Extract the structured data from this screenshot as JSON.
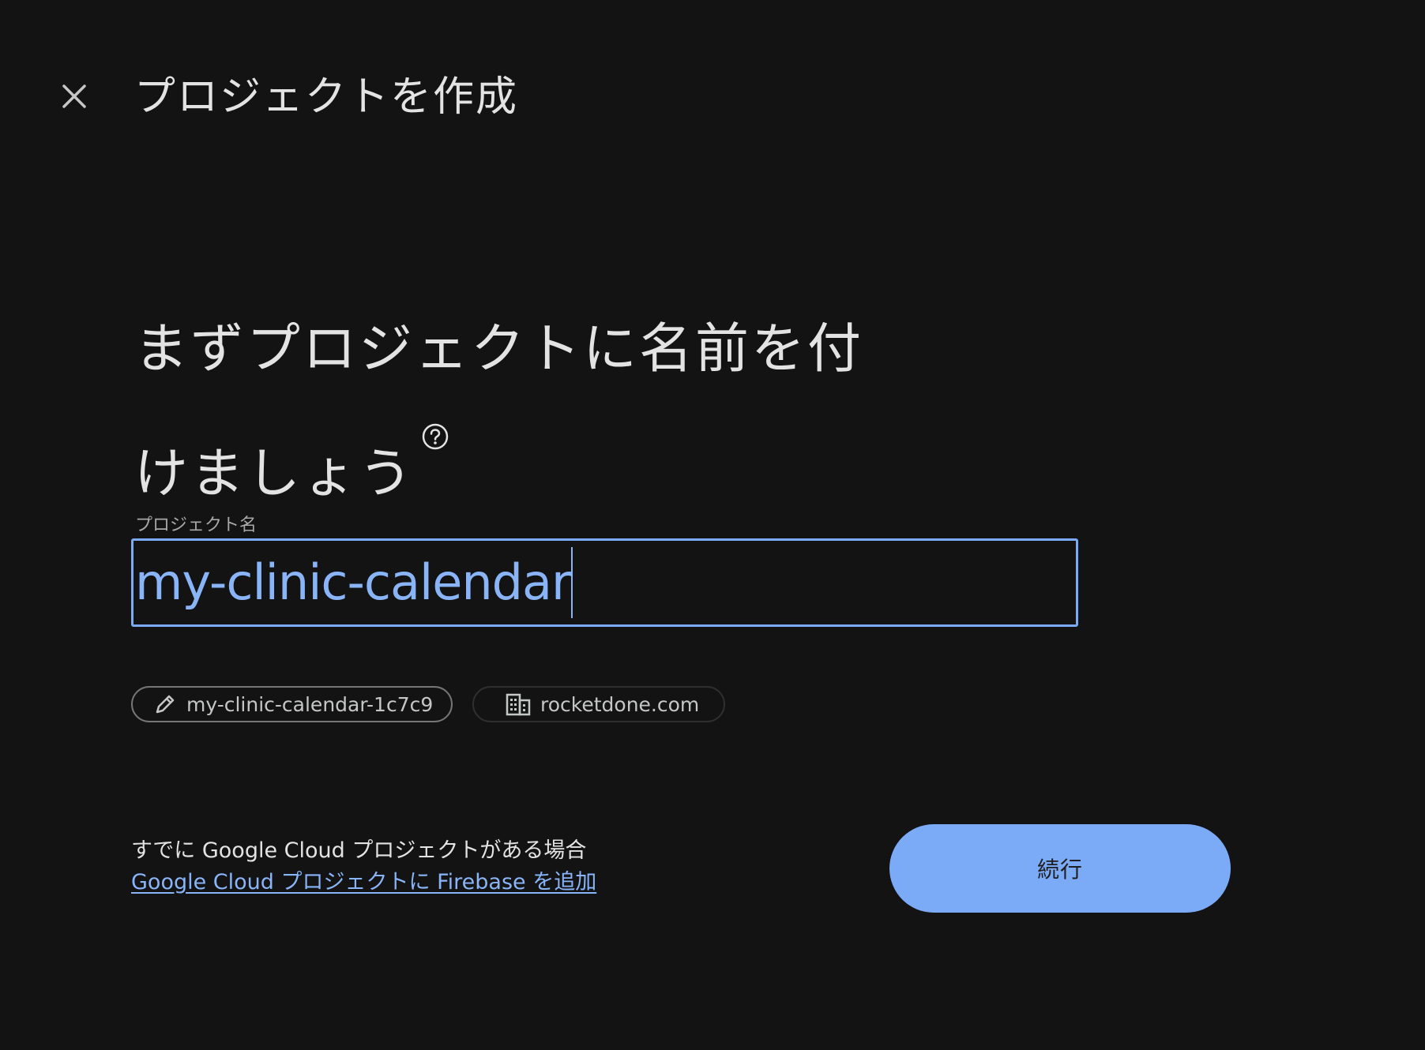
{
  "header": {
    "title": "プロジェクトを作成",
    "close_icon": "close-icon"
  },
  "main": {
    "heading": "まずプロジェクトに名前を付けましょう",
    "help_icon": "help-circle-icon",
    "project_name": {
      "label": "プロジェクト名",
      "value": "my-clinic-calendar"
    },
    "chips": {
      "project_id": {
        "icon": "pencil-icon",
        "label": "my-clinic-calendar-1c7c9"
      },
      "organization": {
        "icon": "building-icon",
        "label": "rocketdone.com"
      }
    }
  },
  "footer": {
    "existing_text": "すでに Google Cloud プロジェクトがある場合",
    "firebase_link": "Google Cloud プロジェクトに Firebase を追加",
    "continue_label": "続行"
  },
  "colors": {
    "background": "#131313",
    "accent": "#8ab4f8",
    "button": "#7baaf7",
    "text": "#e3e3e3"
  }
}
